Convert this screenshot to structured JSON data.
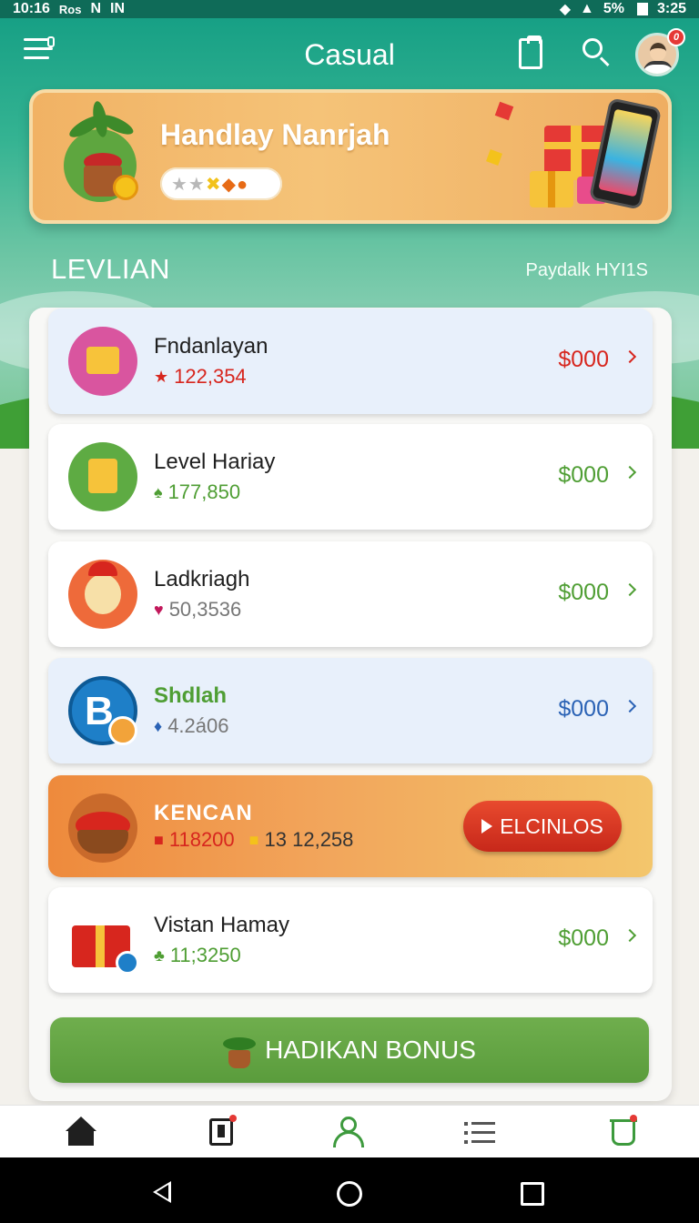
{
  "status_bar": {
    "time": "10:16",
    "left_indicators": [
      "Ros",
      "N",
      "IN"
    ],
    "battery": "5%",
    "clock_right": "3:25"
  },
  "app_bar": {
    "title": "Casual",
    "notification_count": "0"
  },
  "banner": {
    "title": "Handlay Nanrjah",
    "chip": {
      "star1": "★★",
      "star2": "✖",
      "star3": "◆●"
    }
  },
  "section": {
    "title": "LEVLIAN",
    "subtitle": "Paydalk HYI1S"
  },
  "items": [
    {
      "name": "Fndanlayan",
      "meta_icon": "★",
      "value": "122,354",
      "price": "$000",
      "price_color": "#d7261e"
    },
    {
      "name": "Level Hariay",
      "meta_icon": "♠",
      "value": "177,850",
      "price": "$000",
      "price_color": "#4f9e34"
    },
    {
      "name": "Ladkriagh",
      "meta_icon": "♥",
      "value": "50,3536",
      "price": "$000",
      "price_color": "#4f9e34"
    },
    {
      "name": "Shdlah",
      "meta_icon": "♦",
      "value": "4.2á06",
      "price": "$000",
      "price_color": "#2a62b5"
    },
    {
      "name": "Vistan Hamay",
      "meta_icon": "♣",
      "value": "11;3250",
      "price": "$000",
      "price_color": "#4f9e34"
    }
  ],
  "promo": {
    "name": "KENCAN",
    "value1": "118200",
    "value2": "13 12,258",
    "button_label": "ELCINLOS"
  },
  "bonus_button": {
    "label": "HADIKAN BONUS"
  },
  "colors": {
    "brand_green": "#17a085",
    "accent_orange": "#f1b264",
    "button_green": "#5a9c3c"
  }
}
